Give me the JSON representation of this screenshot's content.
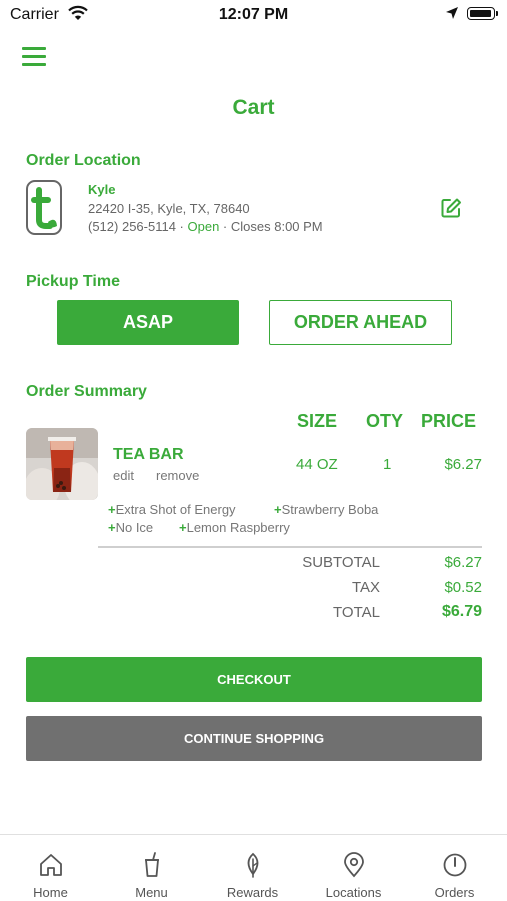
{
  "status_bar": {
    "carrier": "Carrier",
    "time": "12:07 PM"
  },
  "header": {
    "title": "Cart"
  },
  "order_location": {
    "label": "Order Location",
    "store_name": "Kyle",
    "address": "22420 I-35, Kyle, TX, 78640",
    "phone": "(512) 256-5114",
    "separator": " · ",
    "status": "Open",
    "hours": "Closes 8:00 PM"
  },
  "pickup": {
    "label": "Pickup Time",
    "asap": "ASAP",
    "order_ahead": "ORDER AHEAD"
  },
  "summary": {
    "label": "Order Summary",
    "columns": {
      "size": "SIZE",
      "qty": "OTY",
      "price": "PRICE"
    },
    "item": {
      "name": "TEA BAR",
      "edit": "edit",
      "remove": "remove",
      "size": "44 OZ",
      "qty": "1",
      "price": "$6.27",
      "addons": [
        "Extra Shot of Energy",
        "Strawberry Boba",
        "No Ice",
        "Lemon Raspberry"
      ]
    },
    "subtotal_label": "SUBTOTAL",
    "subtotal": "$6.27",
    "tax_label": "TAX",
    "tax": "$0.52",
    "total_label": "TOTAL",
    "total": "$6.79"
  },
  "actions": {
    "checkout": "CHECKOUT",
    "continue": "CONTINUE SHOPPING"
  },
  "tabs": [
    {
      "label": "Home",
      "icon": "home-icon"
    },
    {
      "label": "Menu",
      "icon": "cup-icon"
    },
    {
      "label": "Rewards",
      "icon": "leaf-icon"
    },
    {
      "label": "Locations",
      "icon": "pin-icon"
    },
    {
      "label": "Orders",
      "icon": "clock-icon"
    }
  ],
  "colors": {
    "accent": "#3aaa3a",
    "secondary_button": "#707070"
  }
}
